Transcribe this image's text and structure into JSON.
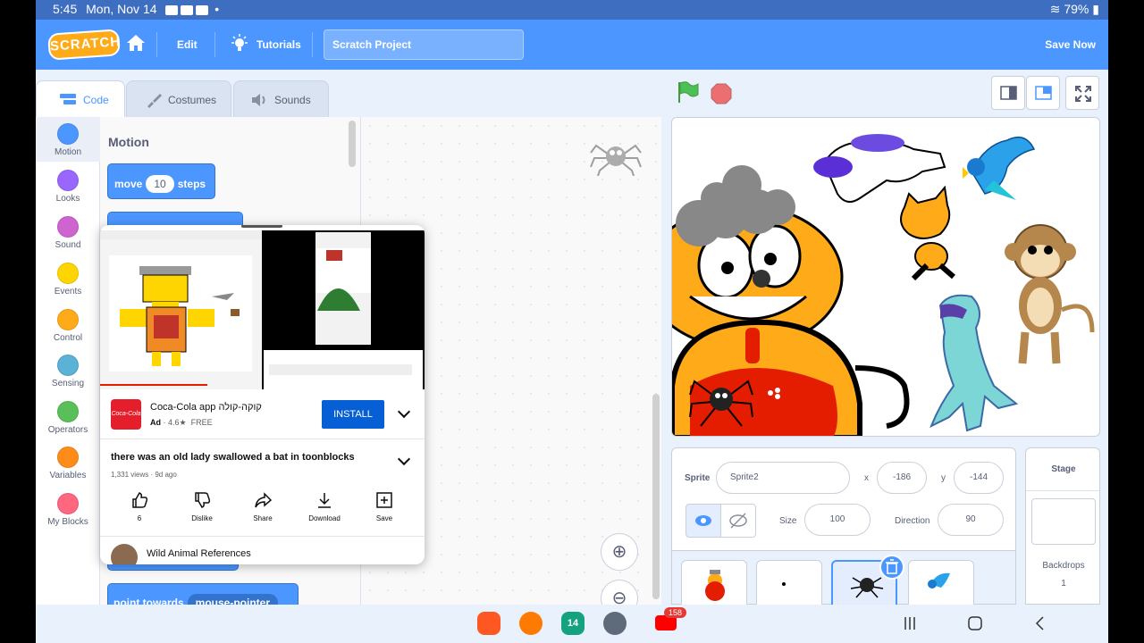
{
  "status_bar": {
    "time": "5:45",
    "date": "Mon, Nov 14",
    "battery": "79%"
  },
  "menu": {
    "edit": "Edit",
    "tutorials": "Tutorials",
    "project_title": "Scratch Project",
    "save_now": "Save Now",
    "logo_text": "SCRATCH"
  },
  "tabs": {
    "code": "Code",
    "costumes": "Costumes",
    "sounds": "Sounds"
  },
  "categories": [
    {
      "label": "Motion",
      "color": "#4c97ff"
    },
    {
      "label": "Looks",
      "color": "#9966ff"
    },
    {
      "label": "Sound",
      "color": "#cf63cf"
    },
    {
      "label": "Events",
      "color": "#ffd500"
    },
    {
      "label": "Control",
      "color": "#ffab19"
    },
    {
      "label": "Sensing",
      "color": "#5cb1d6"
    },
    {
      "label": "Operators",
      "color": "#59c059"
    },
    {
      "label": "Variables",
      "color": "#ff8c1a"
    },
    {
      "label": "My Blocks",
      "color": "#ff6680"
    }
  ],
  "palette": {
    "title": "Motion",
    "move_block": {
      "word1": "move",
      "value": "10",
      "word2": "steps"
    },
    "point_block": {
      "word": "point towards",
      "value": "mouse-pointer"
    }
  },
  "popup": {
    "ad": {
      "title": "Coca-Cola app קוקה-קולה",
      "ad_label": "Ad",
      "rating": "4.6★",
      "price": "FREE",
      "install": "INSTALL",
      "logo_text": "Coca-Cola"
    },
    "video": {
      "title": "there was an old lady swallowed a bat in toonblocks",
      "meta": "1,331 views · 9d ago"
    },
    "actions": {
      "like_count": "6",
      "dislike": "Dislike",
      "share": "Share",
      "download": "Download",
      "save": "Save"
    },
    "channel": "Wild Animal References"
  },
  "sprite_info": {
    "sprite_label": "Sprite",
    "sprite_name": "Sprite2",
    "x_label": "x",
    "x": "-186",
    "y_label": "y",
    "y": "-144",
    "size_label": "Size",
    "size": "100",
    "direction_label": "Direction",
    "direction": "90"
  },
  "stage_pane": {
    "title": "Stage",
    "backdrops_label": "Backdrops",
    "backdrops_count": "1"
  },
  "navbar": {
    "youtube_badge": "158",
    "calendar_day": "14"
  }
}
